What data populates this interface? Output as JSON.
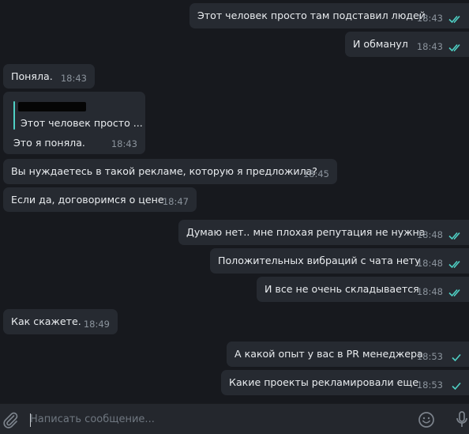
{
  "messages": [
    {
      "text": "Этот человек просто там подставил людей",
      "time": "18:43"
    },
    {
      "text": "И обманул",
      "time": "18:43"
    },
    {
      "text": "Поняла.",
      "time": "18:43"
    },
    {
      "quote": "Этот человек просто ...",
      "text": "Это я поняла.",
      "time": "18:43"
    },
    {
      "text": "Вы нуждаетесь в такой рекламе, которую я предложила?",
      "time": "18:45"
    },
    {
      "text": "Если да, договоримся о цене",
      "time": "18:47"
    },
    {
      "text": "Думаю нет.. мне плохая репутация не нужна",
      "time": "18:48"
    },
    {
      "text": "Положительных вибраций с чата нету",
      "time": "18:48"
    },
    {
      "text": "И все не очень складывается",
      "time": "18:48"
    },
    {
      "text": "Как скажете.",
      "time": "18:49"
    },
    {
      "text": "А какой опыт у вас в PR менеджера",
      "time": "18:53"
    },
    {
      "text": "Какие проекты рекламировали еще",
      "time": "18:53"
    }
  ],
  "composer": {
    "placeholder": "Написать сообщение..."
  },
  "icons": {
    "attach": "paperclip-icon",
    "emoji": "smiley-icon",
    "voice": "microphone-icon",
    "read": "double-check-icon",
    "sent": "single-check-icon"
  },
  "colors": {
    "bubble": "#262a31",
    "check": "#4fd1c5",
    "text": "#e9ecef",
    "time": "#8b939c"
  }
}
